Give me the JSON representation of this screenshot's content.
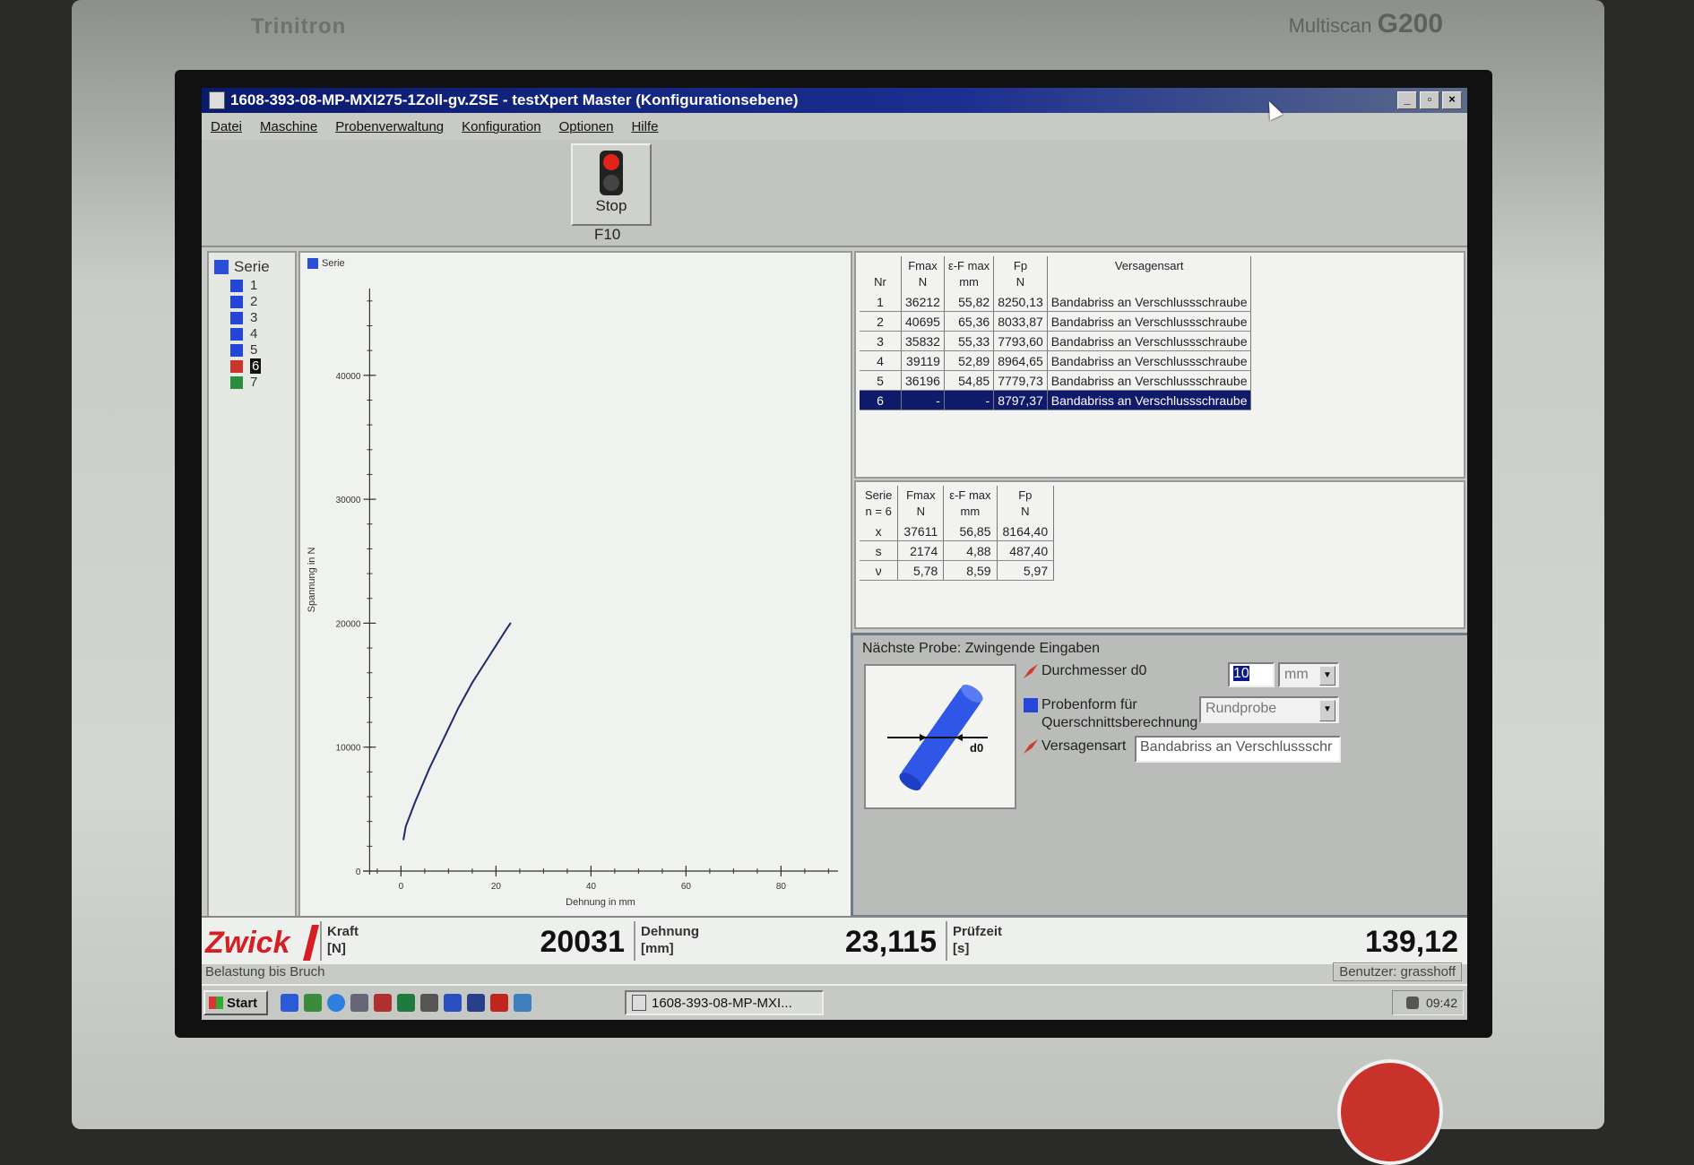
{
  "monitor": {
    "brand": "Trinitron",
    "model_prefix": "Multiscan ",
    "model_suffix": "G200"
  },
  "window": {
    "title": "1608-393-08-MP-MXI275-1Zoll-gv.ZSE - testXpert Master (Konfigurationsebene)"
  },
  "menu": [
    "Datei",
    "Maschine",
    "Probenverwaltung",
    "Konfiguration",
    "Optionen",
    "Hilfe"
  ],
  "toolbar": {
    "stop_label": "Stop",
    "stop_key": "F10"
  },
  "tree": {
    "root": "Serie",
    "items": [
      "1",
      "2",
      "3",
      "4",
      "5",
      "6",
      "7"
    ]
  },
  "chart": {
    "tab_label": "Serie"
  },
  "chart_data": {
    "type": "line",
    "title": "",
    "xlabel": "Dehnung in mm",
    "ylabel": "Spannung in N",
    "xlim": [
      -8,
      92
    ],
    "ylim": [
      0,
      47000
    ],
    "xticks": [
      "0",
      "20",
      "40",
      "60",
      "80"
    ],
    "yticks": [
      "0",
      "10000",
      "20000",
      "30000",
      "40000"
    ],
    "grid": false,
    "series": [
      {
        "x": [
          0.5,
          1,
          2,
          3,
          4,
          5,
          6,
          7,
          8,
          9,
          10,
          11,
          12,
          13,
          14,
          15,
          16,
          17,
          18,
          19,
          20,
          21,
          22,
          23.1
        ],
        "values": [
          2500,
          3600,
          4600,
          5600,
          6500,
          7400,
          8300,
          9100,
          9900,
          10700,
          11500,
          12300,
          13100,
          13800,
          14500,
          15200,
          15800,
          16400,
          17000,
          17600,
          18200,
          18800,
          19400,
          20031
        ]
      }
    ]
  },
  "results": {
    "headers": [
      [
        "Nr",
        ""
      ],
      [
        "Fmax",
        "N"
      ],
      [
        "ε-F max",
        "mm"
      ],
      [
        "Fp",
        "N"
      ],
      [
        "Versagensart",
        ""
      ]
    ],
    "rows": [
      [
        "1",
        "36212",
        "55,82",
        "8250,13",
        "Bandabriss an Verschlussschraube"
      ],
      [
        "2",
        "40695",
        "65,36",
        "8033,87",
        "Bandabriss an Verschlussschraube"
      ],
      [
        "3",
        "35832",
        "55,33",
        "7793,60",
        "Bandabriss an Verschlussschraube"
      ],
      [
        "4",
        "39119",
        "52,89",
        "8964,65",
        "Bandabriss an Verschlussschraube"
      ],
      [
        "5",
        "36196",
        "54,85",
        "7779,73",
        "Bandabriss an Verschlussschraube"
      ],
      [
        "6",
        "-",
        "-",
        "8797,37",
        "Bandabriss an Verschlussschraube"
      ]
    ],
    "selected_row": 5
  },
  "stats": {
    "headers": [
      [
        "Serie",
        "n = 6"
      ],
      [
        "Fmax",
        "N"
      ],
      [
        "ε-F max",
        "mm"
      ],
      [
        "Fp",
        "N"
      ]
    ],
    "rows": [
      [
        "x",
        "37611",
        "56,85",
        "8164,40"
      ],
      [
        "s",
        "2174",
        "4,88",
        "487,40"
      ],
      [
        "ν",
        "5,78",
        "8,59",
        "5,97"
      ]
    ]
  },
  "next_sample": {
    "title": "Nächste Probe: Zwingende Eingaben",
    "diagram_label": "d0",
    "diameter_label": "Durchmesser d0",
    "diameter_value": "10",
    "diameter_unit": "mm",
    "shape_label_1": "Probenform für",
    "shape_label_2": "Querschnittsberechnung",
    "shape_value": "Rundprobe",
    "failure_label": "Versagensart",
    "failure_value": "Bandabriss an Verschlussschr"
  },
  "readout": {
    "brand": "Zwick",
    "force_name": "Kraft",
    "force_unit": "[N]",
    "force_value": "20031",
    "strain_name": "Dehnung",
    "strain_unit": "[mm]",
    "strain_value": "23,115",
    "time_name": "Prüfzeit",
    "time_unit": "[s]",
    "time_value": "139,12"
  },
  "status": {
    "left": "Belastung bis Bruch",
    "right": "Benutzer: grasshoff"
  },
  "taskbar": {
    "start": "Start",
    "task": "1608-393-08-MP-MXI...",
    "clock": "09:42"
  },
  "colors": {
    "accent": "#101a6b",
    "brand": "#d51f24",
    "curve": "#1d2a6b"
  }
}
